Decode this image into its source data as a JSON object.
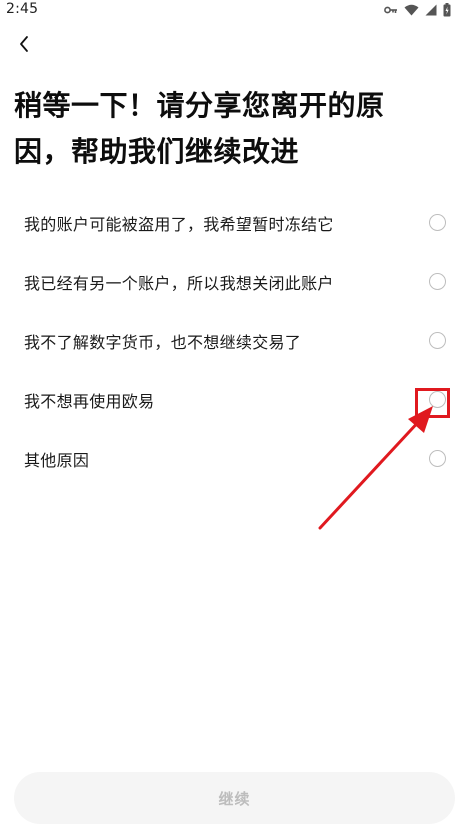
{
  "status_bar": {
    "time": "2:45",
    "icons": [
      "vpn-key-icon",
      "wifi-icon",
      "signal-icon",
      "battery-icon"
    ]
  },
  "header": {
    "back_icon": "chevron-left-icon"
  },
  "title": {
    "line1": "稍等一下！请分享您离开的原",
    "line2": "因，帮助我们继续改进"
  },
  "options": [
    {
      "label": "我的账户可能被盗用了，我希望暂时冻结它",
      "selected": false
    },
    {
      "label": "我已经有另一个账户，所以我想关闭此账户",
      "selected": false
    },
    {
      "label": "我不了解数字货币，也不想继续交易了",
      "selected": false
    },
    {
      "label": "我不想再使用欧易",
      "selected": false
    },
    {
      "label": "其他原因",
      "selected": false
    }
  ],
  "continue_button": {
    "label": "继续",
    "enabled": false
  },
  "annotation": {
    "color": "#e0191f",
    "target": "options.3"
  }
}
